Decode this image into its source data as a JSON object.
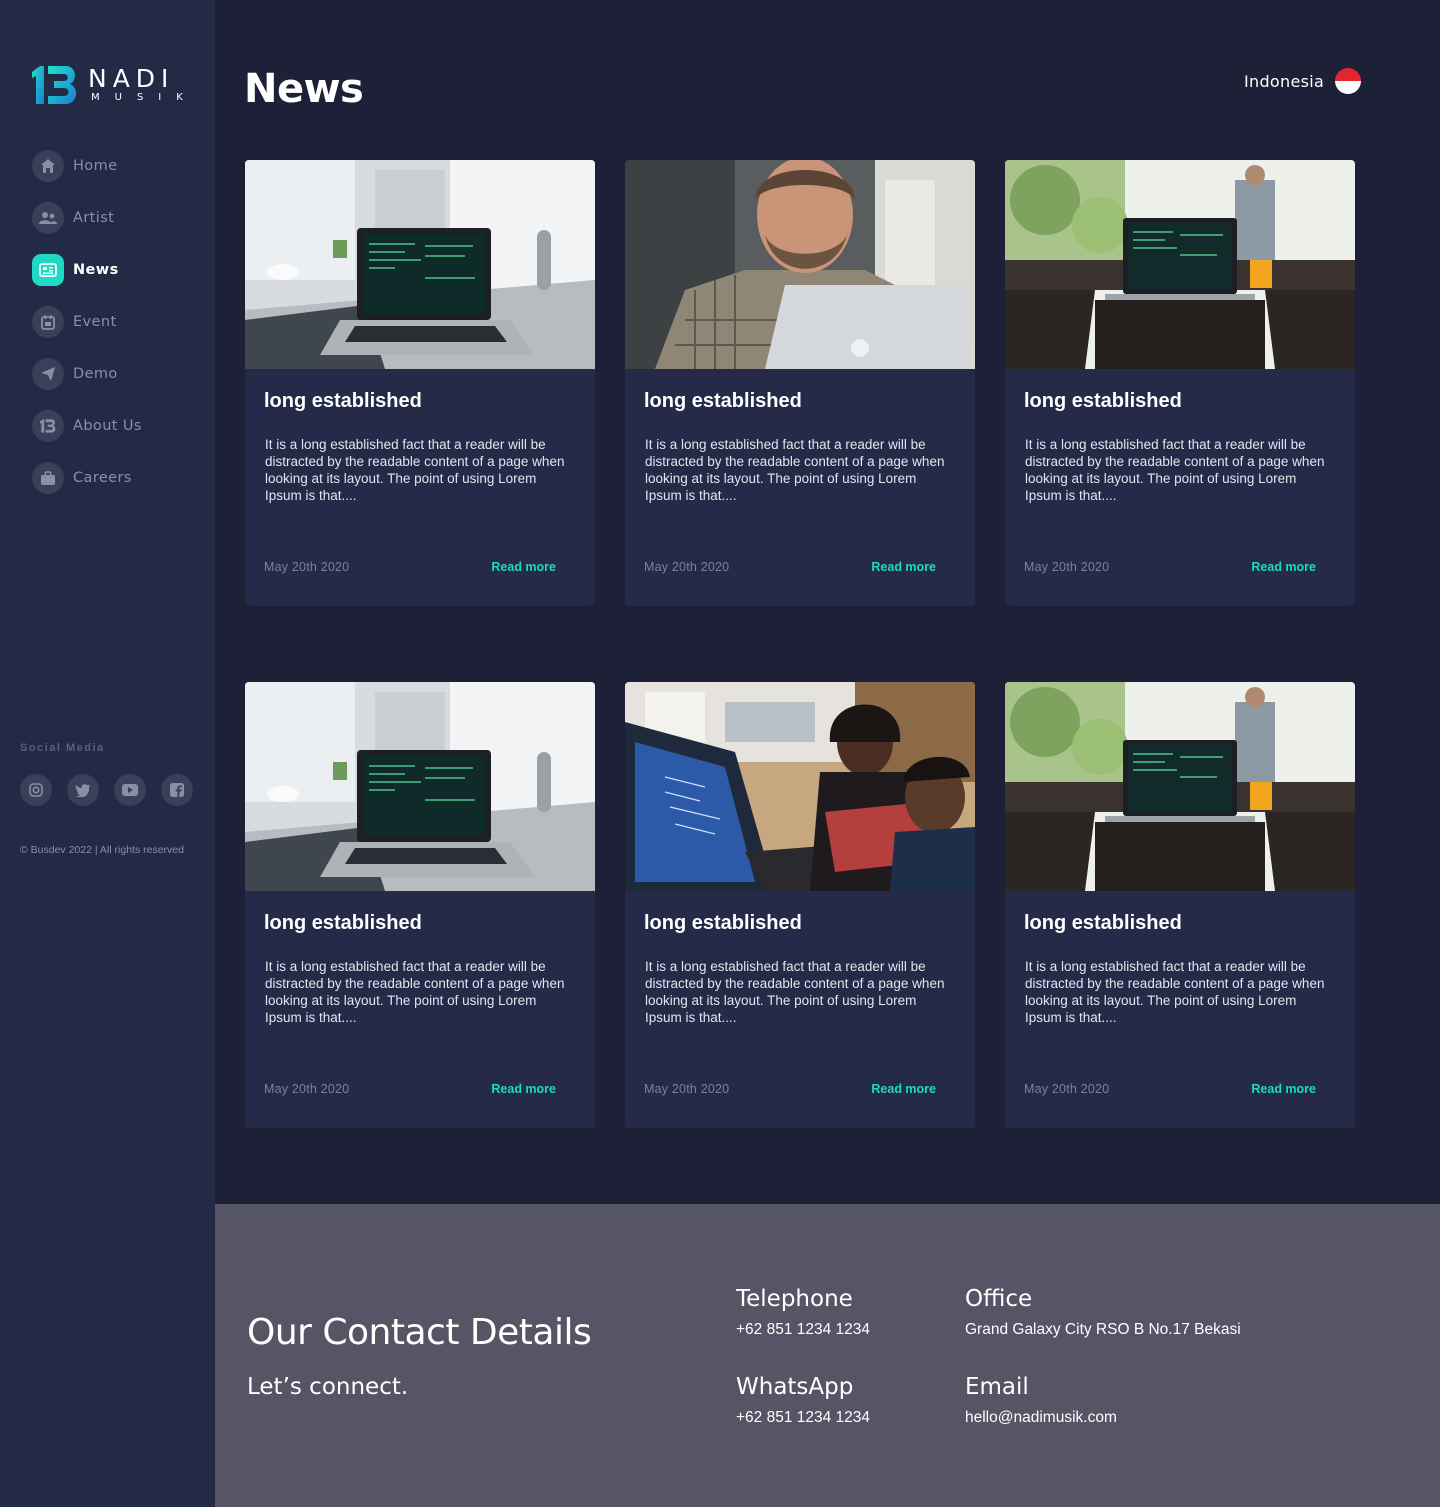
{
  "brand": {
    "name": "NADI",
    "sub": "MUSIK"
  },
  "nav": {
    "items": [
      {
        "label": "Home",
        "icon": "home-icon"
      },
      {
        "label": "Artist",
        "icon": "users-icon"
      },
      {
        "label": "News",
        "icon": "newspaper-icon",
        "active": true
      },
      {
        "label": "Event",
        "icon": "calendar-icon"
      },
      {
        "label": "Demo",
        "icon": "send-icon"
      },
      {
        "label": "About Us",
        "icon": "brand-icon"
      },
      {
        "label": "Careers",
        "icon": "briefcase-icon"
      }
    ]
  },
  "social": {
    "title": "Social Media",
    "icons": [
      "instagram-icon",
      "twitter-icon",
      "youtube-icon",
      "facebook-icon"
    ]
  },
  "copyright": "© Busdev 2022 | All rights reserved",
  "header": {
    "title": "News",
    "language": "Indonesia"
  },
  "cards": [
    {
      "title": "long established",
      "text": "It is a long established fact that a reader will be distracted by the readable content of a page when looking at its layout. The point of using Lorem Ipsum is that....",
      "date": "May 20th 2020",
      "more": "Read more"
    },
    {
      "title": "long established",
      "text": "It is a long established fact that a reader will be distracted by the readable content of a page when looking at its layout. The point of using Lorem Ipsum is that....",
      "date": "May 20th 2020",
      "more": "Read more"
    },
    {
      "title": "long established",
      "text": "It is a long established fact that a reader will be distracted by the readable content of a page when looking at its layout. The point of using Lorem Ipsum is that....",
      "date": "May 20th 2020",
      "more": "Read more"
    },
    {
      "title": "long established",
      "text": "It is a long established fact that a reader will be distracted by the readable content of a page when looking at its layout. The point of using Lorem Ipsum is that....",
      "date": "May 20th 2020",
      "more": "Read more"
    },
    {
      "title": "long established",
      "text": "It is a long established fact that a reader will be distracted by the readable content of a page when looking at its layout. The point of using Lorem Ipsum is that....",
      "date": "May 20th 2020",
      "more": "Read more"
    },
    {
      "title": "long established",
      "text": "It is a long established fact that a reader will be distracted by the readable content of a page when looking at its layout. The point of using Lorem Ipsum is that....",
      "date": "May 20th 2020",
      "more": "Read more"
    }
  ],
  "footer": {
    "title": "Our Contact Details",
    "subtitle": "Let’s connect.",
    "telephone": {
      "label": "Telephone",
      "value": "+62 851 1234 1234"
    },
    "office": {
      "label": "Office",
      "value": "Grand Galaxy City RSO B No.17 Bekasi"
    },
    "whatsapp": {
      "label": "WhatsApp",
      "value": "+62 851 1234 1234"
    },
    "email": {
      "label": "Email",
      "value": "hello@nadimusik.com"
    }
  },
  "colors": {
    "accent": "#1fd9c2",
    "background": "#1d2036",
    "sidebar": "#232a45",
    "card": "#242a48",
    "footer": "#555566"
  }
}
